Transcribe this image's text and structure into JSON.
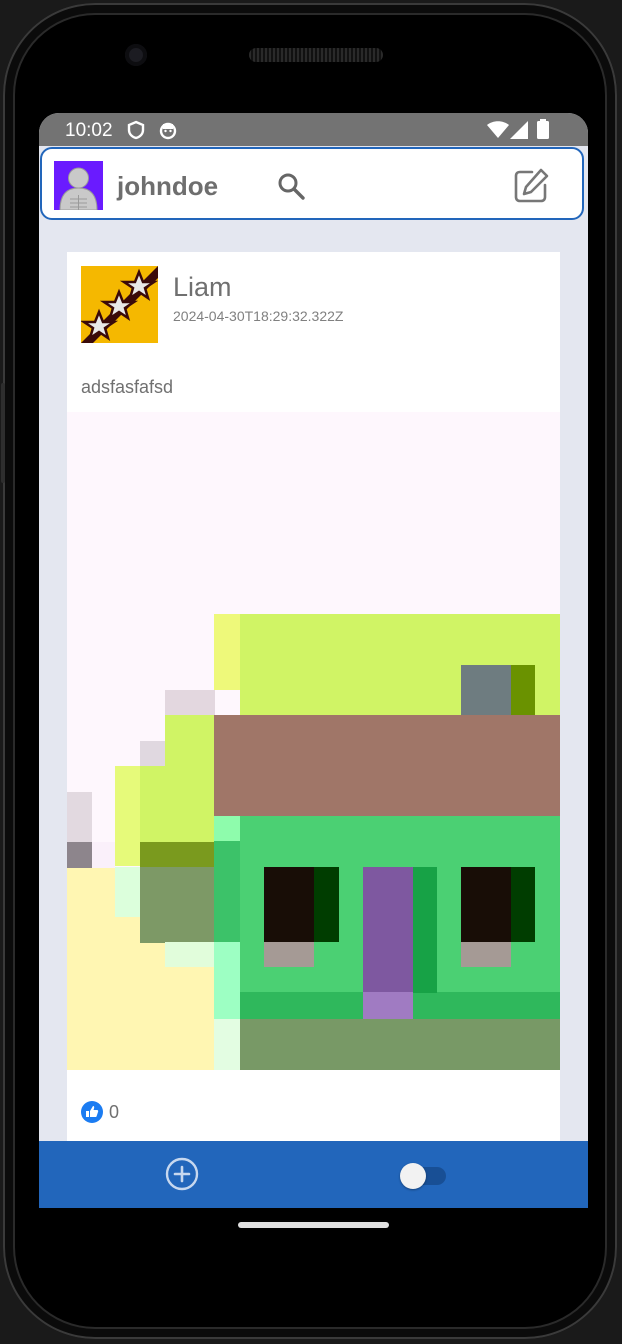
{
  "status_bar": {
    "time": "10:02",
    "left_icons": [
      "shield-icon",
      "android-robot-icon"
    ],
    "right_icons": [
      "wifi-icon",
      "signal-icon",
      "battery-icon"
    ],
    "background": "#737373"
  },
  "app_bar": {
    "username": "johndoe",
    "icons": [
      "search-icon",
      "compose-icon"
    ],
    "border_color": "#2266bb"
  },
  "post": {
    "author": "Liam",
    "timestamp": "2024-04-30T18:29:32.322Z",
    "text": "adsfasfafsd",
    "likes": "0"
  },
  "bottom_bar": {
    "background": "#2266bb",
    "icons": [
      "add-circle-icon",
      "theme-toggle"
    ],
    "toggle_on": false
  }
}
